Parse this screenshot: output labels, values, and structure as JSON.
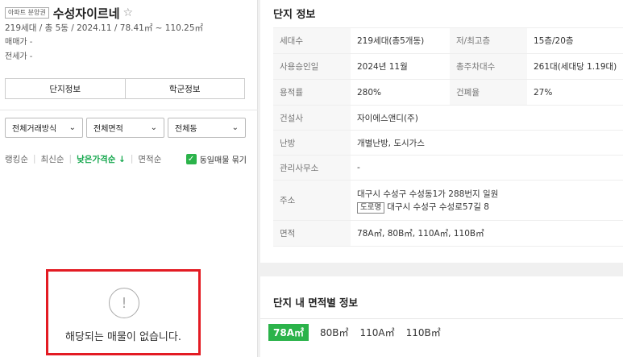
{
  "complex": {
    "badge": "아파트 분양권",
    "name": "수성자이르네",
    "star": "☆",
    "summary": "219세대 / 총 5동 / 2024.11 / 78.41㎡ ~ 110.25㎡",
    "sale_price": "매매가 -",
    "jeonse_price": "전세가 -"
  },
  "tabs": [
    "단지정보",
    "학군정보"
  ],
  "filters": [
    {
      "label": "전체거래방식"
    },
    {
      "label": "전체면적"
    },
    {
      "label": "전체동"
    }
  ],
  "sort": {
    "options": [
      "랭킹순",
      "최신순",
      "낮은가격순 ↓",
      "면적순"
    ],
    "active_index": 2,
    "checkbox_label": "동일매물 묶기"
  },
  "empty": {
    "message": "해당되는 매물이 없습니다."
  },
  "info": {
    "title": "단지 정보",
    "rows": [
      {
        "l1": "세대수",
        "v1": "219세대(총5개동)",
        "l2": "저/최고층",
        "v2": "15층/20층"
      },
      {
        "l1": "사용승인일",
        "v1": "2024년 11월",
        "l2": "총주차대수",
        "v2": "261대(세대당 1.19대)"
      },
      {
        "l1": "용적률",
        "v1": "280%",
        "l2": "건폐율",
        "v2": "27%"
      }
    ],
    "builder_label": "건설사",
    "builder": "자이에스앤디(주)",
    "heating_label": "난방",
    "heating": "개별난방, 도시가스",
    "mgmt_label": "관리사무소",
    "mgmt": "-",
    "address_label": "주소",
    "address_jibun": "대구시 수성구 수성동1가 288번지 일원",
    "road_tag": "도로명",
    "address_road": "대구시 수성구 수성로57길 8",
    "area_label": "면적",
    "area": "78A㎡, 80B㎡, 110A㎡, 110B㎡"
  },
  "area_info": {
    "title": "단지 내 면적별 정보",
    "options": [
      "78A㎡",
      "80B㎡",
      "110A㎡",
      "110B㎡"
    ],
    "active_index": 0
  },
  "colors": {
    "accent_green": "#2bb34a",
    "highlight_red": "#e31b23"
  }
}
